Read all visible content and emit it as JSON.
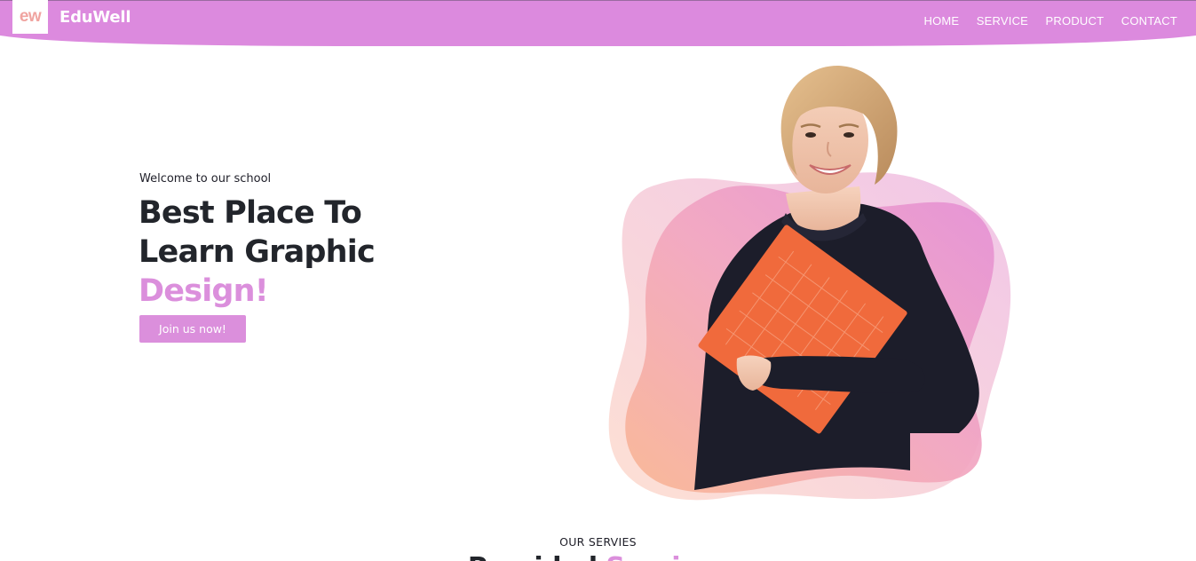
{
  "brand": {
    "logo_text": "ew",
    "name": "EduWell"
  },
  "nav": {
    "items": [
      "HOME",
      "SERVICE",
      "PRODUCT",
      "CONTACT"
    ]
  },
  "hero": {
    "eyebrow": "Welcome to our school",
    "headline_line1": "Best Place To",
    "headline_line2": "Learn Graphic",
    "headline_accent": "Design!",
    "cta_label": "Join us now!",
    "image_alt": "smiling student holding an orange folder"
  },
  "services": {
    "eyebrow": "OUR SERVIES",
    "title_start": "Provided",
    "title_accent": "Services"
  },
  "colors": {
    "primary": "#db8fdc",
    "dark_text": "#22252b",
    "logo_accent": "#f0a4a0",
    "folder_orange": "#f06a3c",
    "sweater": "#1c1d2a"
  }
}
